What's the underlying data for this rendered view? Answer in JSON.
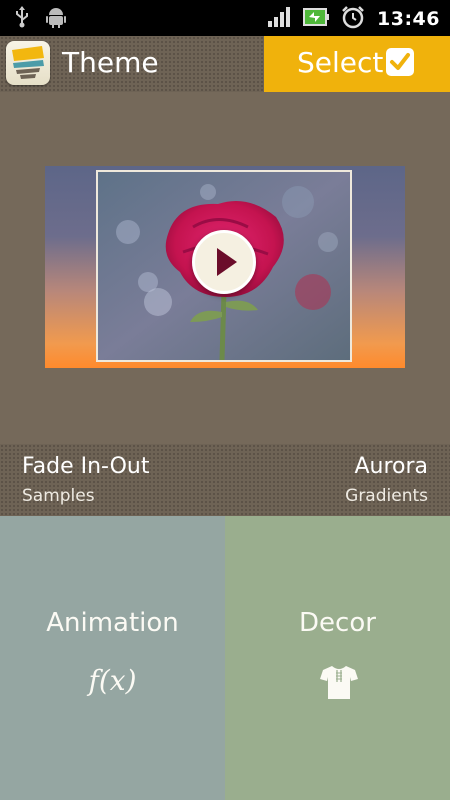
{
  "status_bar": {
    "time": "13:46",
    "icons": [
      "usb-icon",
      "android-debug-icon",
      "signal-icon",
      "battery-icon",
      "alarm-icon"
    ]
  },
  "title_bar": {
    "app_icon": "theme-app-icon",
    "title": "Theme",
    "select_label": "Select",
    "select_icon": "checkmark-icon",
    "accent_color": "#f0b20c"
  },
  "preview": {
    "play_icon": "play-icon"
  },
  "info": {
    "transition_name": "Fade In-Out",
    "transition_category": "Samples",
    "theme_name": "Aurora",
    "theme_category": "Gradients"
  },
  "panels": {
    "animation": {
      "label": "Animation",
      "icon": "fx-icon",
      "icon_text": "f(x)",
      "color": "#95a6a2"
    },
    "decor": {
      "label": "Decor",
      "icon": "tshirt-icon",
      "color": "#9aae8e"
    }
  }
}
